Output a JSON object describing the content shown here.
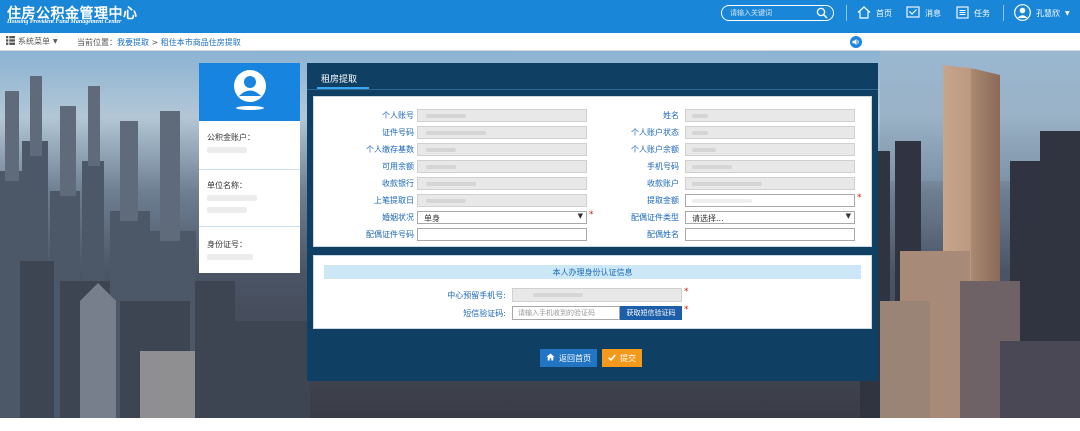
{
  "header": {
    "logo_cn": "住房公积金管理中心",
    "logo_en": "Housing Provident Fund Management Center",
    "search_placeholder": "请输入关键词",
    "nav": {
      "home": "首页",
      "messages": "消息",
      "tasks": "任务",
      "user": "孔慧欣"
    }
  },
  "breadcrumb": {
    "system_menu": "系统菜单",
    "prefix": "当前位置：",
    "link": "我要提取",
    "separator": " > ",
    "current": "租住本市商品住房提取"
  },
  "sidebar_card": {
    "account_label": "公积金账户：",
    "company_label": "单位名称：",
    "id_label": "身份证号："
  },
  "panel": {
    "tab_label": "租房提取",
    "fields": {
      "personal_account": "个人账号",
      "name": "姓名",
      "id_number": "证件号码",
      "account_status": "个人账户状态",
      "deposit_base": "个人缴存基数",
      "account_balance": "个人账户余额",
      "available_balance": "可用余额",
      "phone_number": "手机号码",
      "receiving_bank": "收款银行",
      "receiving_account": "收款账户",
      "last_withdraw_date": "上笔提取日",
      "withdraw_amount": "提取金额",
      "marital_status": "婚姻状况",
      "marital_status_value": "单身",
      "spouse_id_type": "配偶证件类型",
      "spouse_id_type_value": "请选择...",
      "spouse_id_number": "配偶证件号码",
      "spouse_name": "配偶姓名"
    },
    "identity": {
      "section_title": "本人办理身份认证信息",
      "reserved_phone_label": "中心预留手机号:",
      "sms_code_label": "短信验证码:",
      "sms_placeholder": "请输入手机收到的验证码",
      "sms_button": "获取短信验证码"
    },
    "buttons": {
      "home": "返回首页",
      "submit": "提交"
    },
    "required_mark": "*"
  },
  "colors": {
    "header_blue": "#1a86d8",
    "panel_navy": "#0f3f63",
    "submit_orange": "#f39a1c",
    "link_blue": "#1a66b8",
    "required_red": "#d81e06"
  }
}
